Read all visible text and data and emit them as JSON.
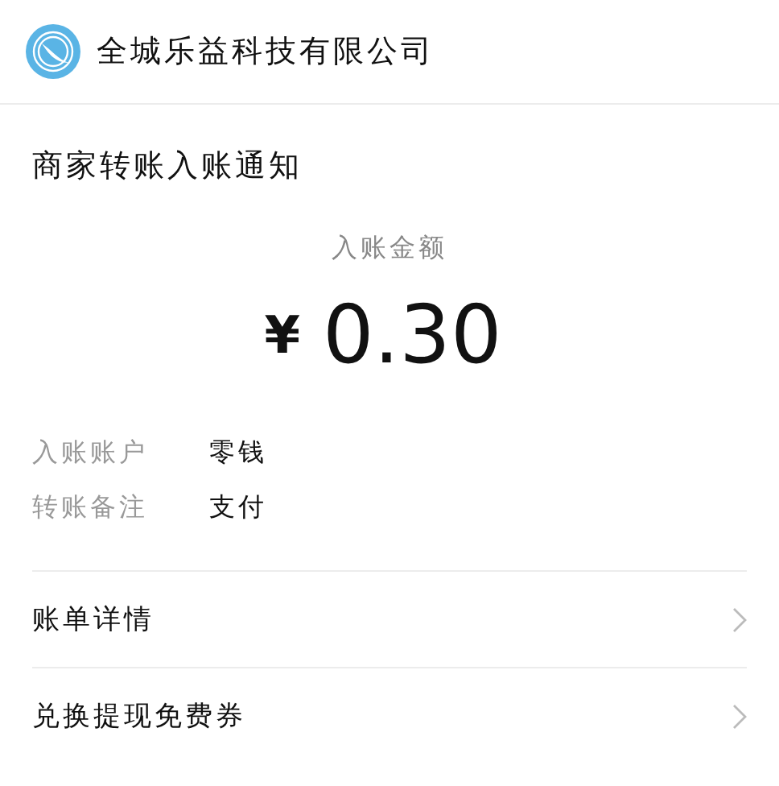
{
  "header": {
    "company": "全城乐益科技有限公司"
  },
  "notice": {
    "title": "商家转账入账通知",
    "amount_label": "入账金额",
    "currency": "¥",
    "amount": "0.30"
  },
  "details": [
    {
      "label": "入账账户",
      "value": "零钱"
    },
    {
      "label": "转账备注",
      "value": "支付"
    }
  ],
  "links": [
    {
      "label": "账单详情"
    },
    {
      "label": "兑换提现免费券"
    }
  ]
}
